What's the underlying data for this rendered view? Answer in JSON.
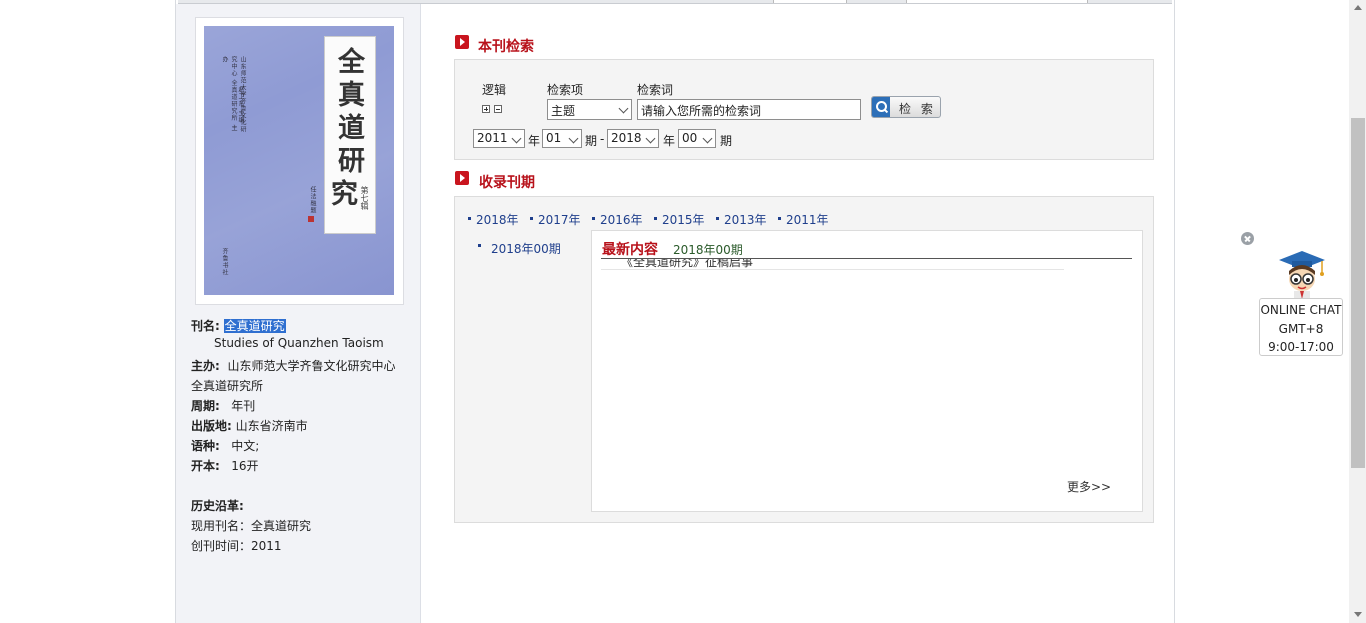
{
  "journal": {
    "cover": {
      "title_chars": [
        "全",
        "真",
        "道",
        "研",
        "究"
      ],
      "volume": "第七辑",
      "editor_line": "赵卫东 主编",
      "series_line": "山东师范大学齐鲁文化研究中心 全真道研究所 主办",
      "publisher_line": "齐鲁书社",
      "signature": "任法融题"
    },
    "title_label": "刊名:",
    "title_value": "全真道研究",
    "english_title": "Studies of Quanzhen Taoism",
    "sponsor_label": "主办:",
    "sponsor_value": "山东师范大学齐鲁文化研究中心",
    "sponsor_value_2": "全真道研究所",
    "frequency_label": "周期:",
    "frequency_value": "年刊",
    "place_label": "出版地:",
    "place_value": "山东省济南市",
    "language_label": "语种:",
    "language_value": "中文;",
    "format_label": "开本:",
    "format_value": "16开",
    "history_label": "历史沿革:",
    "current_name": "现用刊名：全真道研究",
    "start_time": "创刊时间：2011"
  },
  "search": {
    "section_title": "本刊检索",
    "logic_label": "逻辑",
    "field_label": "检索项",
    "term_label": "检索词",
    "field_value": "主题",
    "keyword_value": "请输入您所需的检索词",
    "button_label": "检 索",
    "from_year": "2011",
    "from_issue": "01",
    "to_year": "2018",
    "to_issue": "00",
    "year_char": "年",
    "issue_char": "期",
    "range_sep": "-"
  },
  "issues": {
    "section_title": "收录刊期",
    "years": [
      "2018年",
      "2017年",
      "2016年",
      "2015年",
      "2013年",
      "2011年"
    ],
    "selected_issue": "2018年00期",
    "latest_title": "最新内容",
    "latest_issue": "2018年00期",
    "article_fragment": "《全真道研究》征稿启事",
    "more_label": "更多>>"
  },
  "chat": {
    "line1": "ONLINE CHAT",
    "line2": "GMT+8",
    "line3": "9:00-17:00"
  }
}
